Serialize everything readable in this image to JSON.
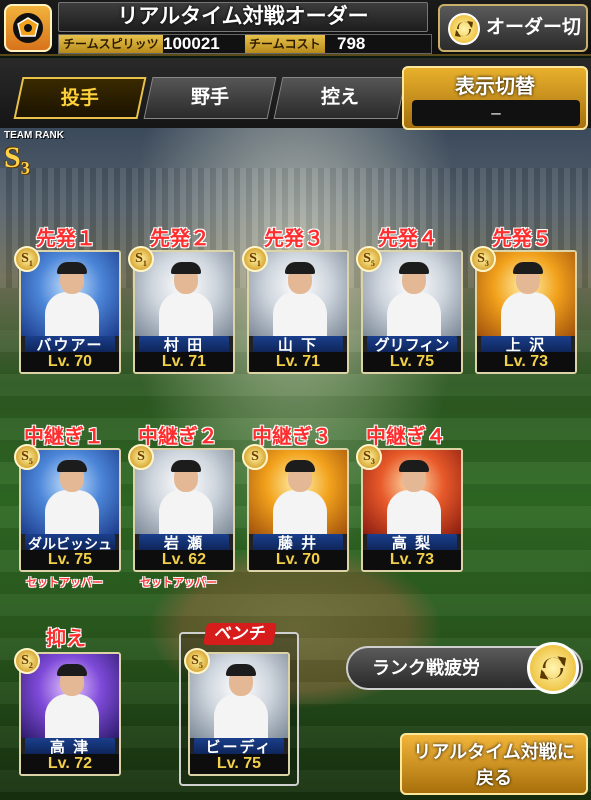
{
  "header": {
    "title": "リアルタイム対戦オーダー",
    "team_spirits_label": "チームスピリッツ",
    "team_spirits_value": "100021",
    "team_cost_label": "チームコスト",
    "team_cost_value": "798",
    "order_switch_label": "オーダー切替"
  },
  "tabs": [
    {
      "label": "投手",
      "active": true
    },
    {
      "label": "野手",
      "active": false
    },
    {
      "label": "控え",
      "active": false
    }
  ],
  "display_switch": {
    "label": "表示切替",
    "value": "–"
  },
  "team_rank": {
    "label": "TEAM RANK",
    "rank": "S",
    "sub": "3"
  },
  "starters": [
    {
      "slot": "先発１",
      "name": "バウアー",
      "level": "Lv. 70",
      "badge": "S",
      "badge_sub": "1",
      "art": "blue"
    },
    {
      "slot": "先発２",
      "name": "村 田",
      "level": "Lv. 71",
      "badge": "S",
      "badge_sub": "1",
      "art": "white"
    },
    {
      "slot": "先発３",
      "name": "山 下",
      "level": "Lv. 71",
      "badge": "S",
      "badge_sub": "1",
      "art": "white"
    },
    {
      "slot": "先発４",
      "name": "グリフィン",
      "level": "Lv. 75",
      "badge": "S",
      "badge_sub": "5",
      "art": "white"
    },
    {
      "slot": "先発５",
      "name": "上 沢",
      "level": "Lv. 73",
      "badge": "S",
      "badge_sub": "3",
      "art": "gold"
    }
  ],
  "relievers": [
    {
      "slot": "中継ぎ１",
      "name": "ダルビッシュ",
      "level": "Lv. 75",
      "badge": "S",
      "badge_sub": "5",
      "art": "blue",
      "role": "セットアッパー"
    },
    {
      "slot": "中継ぎ２",
      "name": "岩 瀬",
      "level": "Lv. 62",
      "badge": "S",
      "badge_sub": "",
      "art": "blue",
      "role": "セットアッパー"
    },
    {
      "slot": "中継ぎ３",
      "name": "藤 井",
      "level": "Lv. 70",
      "badge": "S",
      "badge_sub": "",
      "art": "gold",
      "role": ""
    },
    {
      "slot": "中継ぎ４",
      "name": "高 梨",
      "level": "Lv. 73",
      "badge": "S",
      "badge_sub": "3",
      "art": "red",
      "role": ""
    }
  ],
  "closer": {
    "slot": "抑え",
    "name": "高 津",
    "level": "Lv. 72",
    "badge": "S",
    "badge_sub": "2",
    "art": "purple"
  },
  "bench": {
    "slot": "ベンチ",
    "name": "ビーディ",
    "level": "Lv. 75",
    "badge": "S",
    "badge_sub": "5",
    "art": "white"
  },
  "fatigue_button": {
    "label": "ランク戦疲労"
  },
  "return_button": {
    "label_line1": "リアルタイム対戦に",
    "label_line2": "戻る"
  }
}
